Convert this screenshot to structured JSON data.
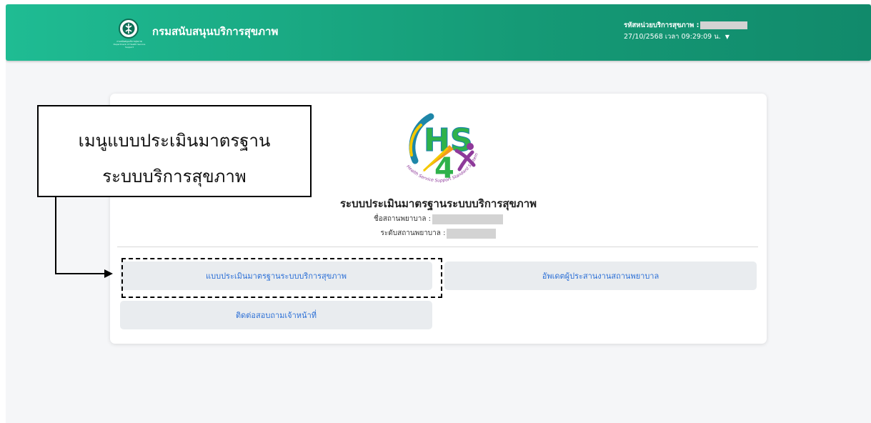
{
  "header": {
    "brand_name": "กรมสนับสนุนบริการสุขภาพ",
    "emblem_caption": "กรมสนับสนุนบริการสุขภาพ Department of Health Service Support",
    "unit_label": "รหัสหน่วยบริการสุขภาพ :",
    "datetime": "27/10/2568 เวลา 09:29:09 น."
  },
  "card": {
    "logo": {
      "letters_top": "HS",
      "number": "4",
      "ring_text": "Health Service Support Standard System",
      "colors": {
        "green": "#2fb24a",
        "teal": "#1e86a8",
        "purple": "#8e3a9a",
        "orange": "#f29a1f",
        "yellow": "#f5c800"
      }
    },
    "system_title": "ระบบประเมินมาตรฐานระบบบริการสุขภาพ",
    "hospital_name_label": "ชื่อสถานพยาบาล :",
    "hospital_level_label": "ระดับสถานพยาบาล :",
    "buttons": {
      "assessment": "แบบประเมินมาตรฐานระบบบริการสุขภาพ",
      "update_coordinator": "อัพเดตผู้ประสานงานสถานพยาบาล",
      "contact_staff": "ติดต่อสอบถามเจ้าหน้าที่"
    }
  },
  "annotation": {
    "line1": "เมนูแบบประเมินมาตรฐาน",
    "line2": "ระบบบริการสุขภาพ"
  }
}
